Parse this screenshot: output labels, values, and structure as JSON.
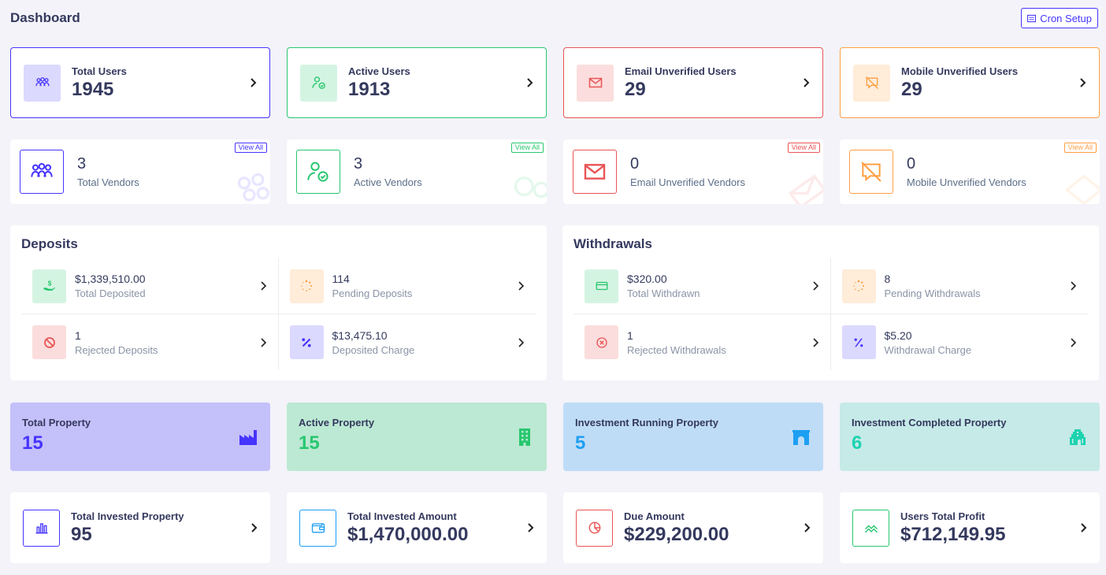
{
  "header": {
    "title": "Dashboard",
    "cron_button": "Cron Setup"
  },
  "user_cards": [
    {
      "label": "Total Users",
      "value": "1945",
      "color": "#4634ff",
      "bg": "#dcd9ff",
      "icon": "users-icon"
    },
    {
      "label": "Active Users",
      "value": "1913",
      "color": "#28c76f",
      "bg": "#d4f4e2",
      "icon": "user-check-icon"
    },
    {
      "label": "Email Unverified Users",
      "value": "29",
      "color": "#ea5455",
      "bg": "#fbdddd",
      "icon": "envelope-icon"
    },
    {
      "label": "Mobile Unverified Users",
      "value": "29",
      "color": "#ff9f43",
      "bg": "#ffecd9",
      "icon": "comment-slash-icon"
    }
  ],
  "vendor_cards": [
    {
      "count": "3",
      "label": "Total Vendors",
      "view_all": "View All",
      "color": "#4634ff",
      "icon": "users-icon"
    },
    {
      "count": "3",
      "label": "Active Vendors",
      "view_all": "View All",
      "color": "#28c76f",
      "icon": "user-check-icon"
    },
    {
      "count": "0",
      "label": "Email Unverified Vendors",
      "view_all": "View All",
      "color": "#ea5455",
      "icon": "envelope-icon"
    },
    {
      "count": "0",
      "label": "Mobile Unverified Vendors",
      "view_all": "View All",
      "color": "#ff9f43",
      "icon": "comment-slash-icon"
    }
  ],
  "deposits": {
    "title": "Deposits",
    "items": [
      {
        "amount": "$1,339,510.00",
        "label": "Total Deposited",
        "color": "#28c76f",
        "bg": "#d4f4e2",
        "icon": "hand-holding-dollar-icon"
      },
      {
        "amount": "114",
        "label": "Pending Deposits",
        "color": "#ff9f43",
        "bg": "#ffecd9",
        "icon": "spinner-icon"
      },
      {
        "amount": "1",
        "label": "Rejected Deposits",
        "color": "#ea5455",
        "bg": "#fbdddd",
        "icon": "ban-icon"
      },
      {
        "amount": "$13,475.10",
        "label": "Deposited Charge",
        "color": "#4634ff",
        "bg": "#dcd9ff",
        "icon": "percent-icon"
      }
    ]
  },
  "withdrawals": {
    "title": "Withdrawals",
    "items": [
      {
        "amount": "$320.00",
        "label": "Total Withdrawn",
        "color": "#28c76f",
        "bg": "#d4f4e2",
        "icon": "money-bill-icon"
      },
      {
        "amount": "8",
        "label": "Pending Withdrawals",
        "color": "#ff9f43",
        "bg": "#ffecd9",
        "icon": "spinner-icon"
      },
      {
        "amount": "1",
        "label": "Rejected Withdrawals",
        "color": "#ea5455",
        "bg": "#fbdddd",
        "icon": "times-circle-icon"
      },
      {
        "amount": "$5.20",
        "label": "Withdrawal Charge",
        "color": "#4634ff",
        "bg": "#dcd9ff",
        "icon": "percent-icon"
      }
    ]
  },
  "property_cards": [
    {
      "label": "Total Property",
      "value": "15",
      "bg": "#c4c0fa",
      "color": "#4634ff",
      "icon": "industry-icon"
    },
    {
      "label": "Active Property",
      "value": "15",
      "bg": "#bce9d3",
      "color": "#28c76f",
      "icon": "building-icon"
    },
    {
      "label": "Investment Running Property",
      "value": "5",
      "bg": "#bfdcf6",
      "color": "#1e9ff2",
      "icon": "archway-icon"
    },
    {
      "label": "Investment Completed Property",
      "value": "6",
      "bg": "#c6eae8",
      "color": "#1dd3b0",
      "icon": "gopuram-icon"
    }
  ],
  "invest_cards": [
    {
      "label": "Total Invested Property",
      "value": "95",
      "color": "#4634ff",
      "icon": "chart-bar-icon"
    },
    {
      "label": "Total Invested Amount",
      "value": "$1,470,000.00",
      "color": "#1e9ff2",
      "icon": "wallet-icon"
    },
    {
      "label": "Due Amount",
      "value": "$229,200.00",
      "color": "#ea5455",
      "icon": "chart-pie-icon"
    },
    {
      "label": "Users Total Profit",
      "value": "$712,149.95",
      "color": "#28c76f",
      "icon": "chart-line-icon"
    }
  ]
}
